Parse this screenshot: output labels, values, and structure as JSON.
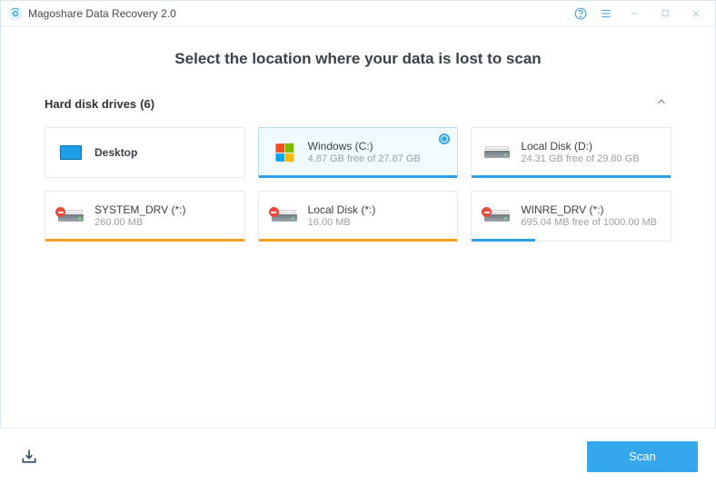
{
  "titlebar": {
    "app_title": "Magoshare Data Recovery 2.0"
  },
  "headline": "Select the location where your data is lost to scan",
  "section": {
    "title": "Hard disk drives",
    "count": "(6)"
  },
  "drives": [
    {
      "name": "Desktop",
      "sub": "",
      "bold": true,
      "icon": "desktop",
      "err": false,
      "selected": false,
      "bar": null
    },
    {
      "name": "Windows (C:)",
      "sub": "4.87 GB free of 27.87 GB",
      "bold": false,
      "icon": "winlogo",
      "err": false,
      "selected": true,
      "bar": {
        "color": "blue",
        "pct": 100
      }
    },
    {
      "name": "Local Disk (D:)",
      "sub": "24.31 GB free of 29.80 GB",
      "bold": false,
      "icon": "tray",
      "err": false,
      "selected": false,
      "bar": {
        "color": "blue",
        "pct": 100
      }
    },
    {
      "name": "SYSTEM_DRV (*:)",
      "sub": "260.00 MB",
      "bold": false,
      "icon": "tray",
      "err": true,
      "selected": false,
      "bar": {
        "color": "amber",
        "pct": 100
      }
    },
    {
      "name": "Local Disk (*:)",
      "sub": "16.00 MB",
      "bold": false,
      "icon": "tray",
      "err": true,
      "selected": false,
      "bar": {
        "color": "amber",
        "pct": 100
      }
    },
    {
      "name": "WINRE_DRV (*:)",
      "sub": "695.04 MB free of 1000.00 MB",
      "bold": false,
      "icon": "tray",
      "err": true,
      "selected": false,
      "bar": {
        "color": "blue",
        "pct": 32
      }
    }
  ],
  "footer": {
    "scan_label": "Scan"
  }
}
